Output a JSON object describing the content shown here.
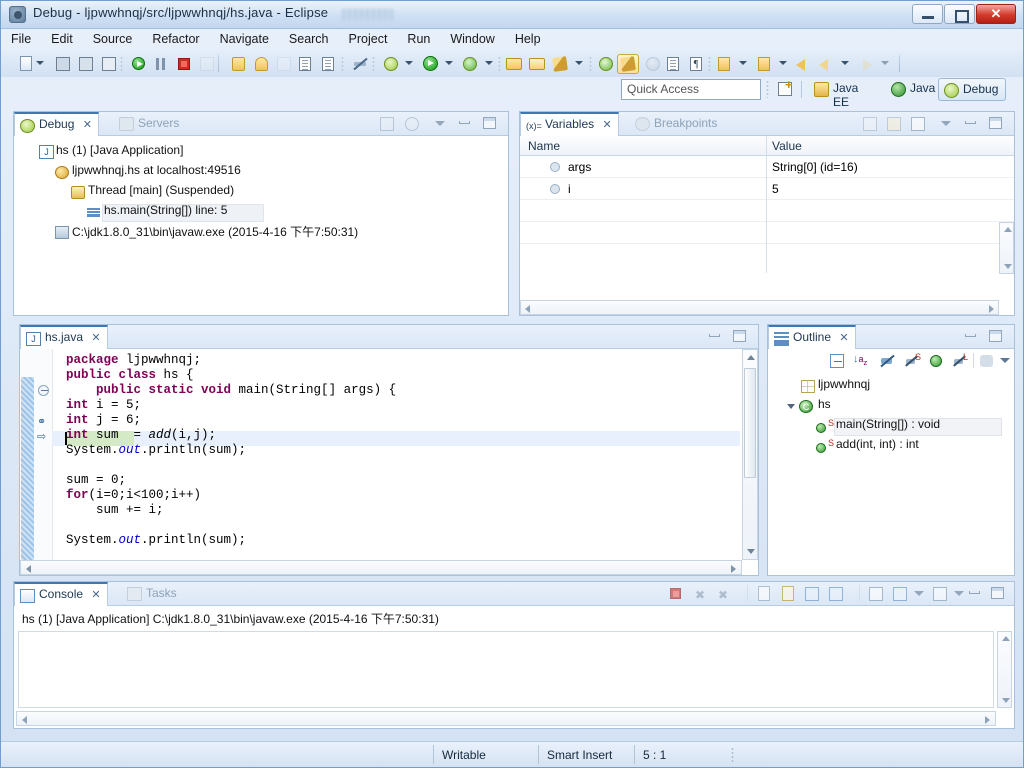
{
  "window": {
    "title": "Debug - ljpwwhnqj/src/ljpwwhnqj/hs.java - Eclipse",
    "app_icon": "eclipse-icon",
    "minimize": "–",
    "maximize": "□",
    "close": "✕"
  },
  "menu": {
    "items": [
      {
        "label": "File"
      },
      {
        "label": "Edit"
      },
      {
        "label": "Source"
      },
      {
        "label": "Refactor"
      },
      {
        "label": "Navigate"
      },
      {
        "label": "Search"
      },
      {
        "label": "Project"
      },
      {
        "label": "Run"
      },
      {
        "label": "Window"
      },
      {
        "label": "Help"
      }
    ]
  },
  "toolbar": {
    "items": [
      {
        "name": "new-wizard-icon"
      },
      {
        "name": "save-icon"
      },
      {
        "name": "save-all-icon"
      },
      {
        "name": "print-icon"
      },
      {
        "name": "resume-icon"
      },
      {
        "name": "suspend-icon"
      },
      {
        "name": "terminate-icon"
      },
      {
        "name": "disconnect-icon"
      },
      {
        "name": "skip-breakpoints-icon"
      },
      {
        "name": "external-tools-icon"
      },
      {
        "name": "debug-icon"
      },
      {
        "name": "run-icon"
      },
      {
        "name": "coverage-icon"
      },
      {
        "name": "open-type-icon"
      },
      {
        "name": "open-task-icon"
      },
      {
        "name": "search-icon"
      },
      {
        "name": "marker-icon"
      },
      {
        "name": "toggle-mark-occurrences-icon"
      },
      {
        "name": "last-edit-location-icon"
      },
      {
        "name": "next-annotation-icon"
      },
      {
        "name": "previous-annotation-icon"
      },
      {
        "name": "back-icon"
      },
      {
        "name": "forward-icon"
      }
    ]
  },
  "quick_access": {
    "placeholder": "Quick Access",
    "value": ""
  },
  "perspectives": {
    "new_perspective": "open-perspective-icon",
    "items": [
      {
        "label": "Java EE",
        "icon": "java-ee-perspective-icon",
        "active": false
      },
      {
        "label": "Java",
        "icon": "java-perspective-icon",
        "active": false
      },
      {
        "label": "Debug",
        "icon": "debug-perspective-icon",
        "active": true
      }
    ]
  },
  "debug_view": {
    "tabs": [
      {
        "label": "Debug",
        "active": true,
        "icon": "debug-icon",
        "close": "✕"
      },
      {
        "label": "Servers",
        "active": false,
        "icon": "servers-icon"
      }
    ],
    "tree": [
      {
        "label": "hs (1) [Java Application]",
        "depth": 0,
        "twisty": "open",
        "icon": "launch-icon"
      },
      {
        "label": "ljpwwhnqj.hs at localhost:49516",
        "depth": 1,
        "twisty": "open",
        "icon": "debug-target-icon"
      },
      {
        "label": "Thread [main] (Suspended)",
        "depth": 2,
        "twisty": "open",
        "icon": "thread-icon"
      },
      {
        "label": "hs.main(String[]) line: 5",
        "depth": 3,
        "twisty": "none",
        "icon": "stack-frame-icon",
        "selected": true
      },
      {
        "label": "C:\\jdk1.8.0_31\\bin\\javaw.exe (2015-4-16 下午7:50:31)",
        "depth": 1,
        "twisty": "none",
        "icon": "process-icon"
      }
    ]
  },
  "variables_view": {
    "tabs": [
      {
        "label": "Variables",
        "active": true,
        "icon": "variables-icon",
        "close": "✕"
      },
      {
        "label": "Breakpoints",
        "active": false,
        "icon": "breakpoints-icon"
      }
    ],
    "columns": [
      "Name",
      "Value"
    ],
    "rows": [
      {
        "name": "args",
        "value": "String[0]  (id=16)",
        "icon": "variable-icon"
      },
      {
        "name": "i",
        "value": "5",
        "icon": "variable-icon"
      }
    ]
  },
  "editor": {
    "tabs": [
      {
        "label": "hs.java",
        "active": true,
        "icon": "java-file-icon",
        "close": "✕"
      }
    ],
    "lines": [
      "package ljpwwhnqj;",
      "public class hs {",
      "    public static void main(String[] args) {",
      "int i = 5;",
      "int j = 6;",
      "int sum  = add(i,j);",
      "System.out.println(sum);",
      "",
      "sum = 0;",
      "for(i=0;i<100;i++)",
      "    sum += i;",
      "",
      "System.out.println(sum);"
    ],
    "current_line_index": 4,
    "current_line_text": "int j = 6;"
  },
  "outline_view": {
    "tabs": [
      {
        "label": "Outline",
        "active": true,
        "icon": "outline-icon",
        "close": "✕"
      }
    ],
    "toolbar": [
      {
        "name": "collapse-all-icon"
      },
      {
        "name": "sort-icon"
      },
      {
        "name": "hide-fields-icon"
      },
      {
        "name": "hide-static-icon"
      },
      {
        "name": "hide-nonpublic-icon"
      },
      {
        "name": "hide-local-types-icon"
      },
      {
        "name": "view-menu-icon"
      },
      {
        "name": "chevron-down-icon"
      }
    ],
    "tree": [
      {
        "label": "ljpwwhnqj",
        "depth": 0,
        "twisty": "none",
        "icon": "package-icon"
      },
      {
        "label": "hs",
        "depth": 0,
        "twisty": "open",
        "icon": "class-icon"
      },
      {
        "label": "main(String[]) : void",
        "depth": 1,
        "twisty": "none",
        "icon": "method-public-static-icon",
        "selected": true
      },
      {
        "label": "add(int, int) : int",
        "depth": 1,
        "twisty": "none",
        "icon": "method-public-static-icon",
        "return_type": "int"
      }
    ]
  },
  "console_view": {
    "tabs": [
      {
        "label": "Console",
        "active": true,
        "icon": "console-icon",
        "close": "✕"
      },
      {
        "label": "Tasks",
        "active": false,
        "icon": "tasks-icon"
      }
    ],
    "toolbar": [
      {
        "name": "terminate-icon"
      },
      {
        "name": "remove-launch-icon"
      },
      {
        "name": "remove-all-terminated-icon"
      },
      {
        "name": "clear-console-icon"
      },
      {
        "name": "scroll-lock-icon"
      },
      {
        "name": "show-console-on-output-icon"
      },
      {
        "name": "show-console-on-error-icon"
      },
      {
        "name": "pin-console-icon"
      },
      {
        "name": "display-selected-console-icon"
      },
      {
        "name": "open-console-icon"
      },
      {
        "name": "minimize-icon"
      },
      {
        "name": "maximize-icon"
      }
    ],
    "header_line": "hs (1) [Java Application] C:\\jdk1.8.0_31\\bin\\javaw.exe (2015-4-16 下午7:50:31)",
    "output": ""
  },
  "status_bar": {
    "writable": "Writable",
    "insert_mode": "Smart Insert",
    "cursor_position": "5 : 1"
  },
  "colors": {
    "accent": "#3c78b5",
    "keyword": "#7f0055",
    "field": "#0000c0",
    "current_line": "#e8f0fe",
    "occurrence_highlight": "#d4e9c6",
    "chrome": "#d3e1f3",
    "close_red": "#d23b2c"
  }
}
